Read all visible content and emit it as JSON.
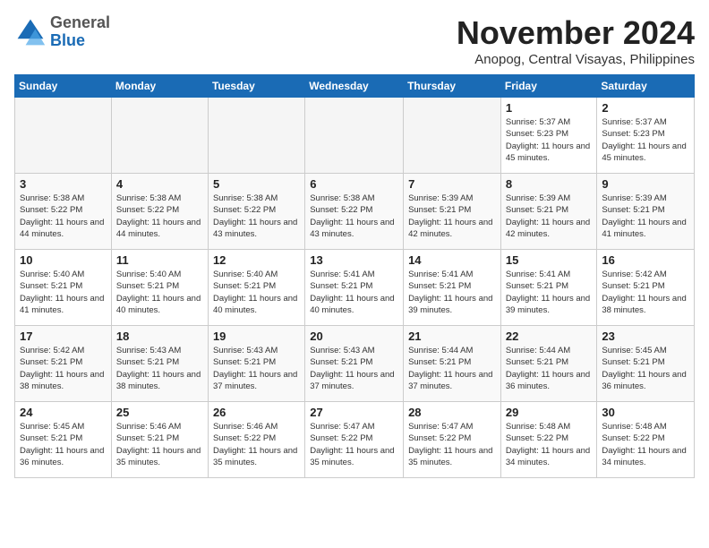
{
  "logo": {
    "general": "General",
    "blue": "Blue"
  },
  "header": {
    "title": "November 2024",
    "location": "Anopog, Central Visayas, Philippines"
  },
  "weekdays": [
    "Sunday",
    "Monday",
    "Tuesday",
    "Wednesday",
    "Thursday",
    "Friday",
    "Saturday"
  ],
  "weeks": [
    [
      {
        "day": "",
        "info": ""
      },
      {
        "day": "",
        "info": ""
      },
      {
        "day": "",
        "info": ""
      },
      {
        "day": "",
        "info": ""
      },
      {
        "day": "",
        "info": ""
      },
      {
        "day": "1",
        "info": "Sunrise: 5:37 AM\nSunset: 5:23 PM\nDaylight: 11 hours and 45 minutes."
      },
      {
        "day": "2",
        "info": "Sunrise: 5:37 AM\nSunset: 5:23 PM\nDaylight: 11 hours and 45 minutes."
      }
    ],
    [
      {
        "day": "3",
        "info": "Sunrise: 5:38 AM\nSunset: 5:22 PM\nDaylight: 11 hours and 44 minutes."
      },
      {
        "day": "4",
        "info": "Sunrise: 5:38 AM\nSunset: 5:22 PM\nDaylight: 11 hours and 44 minutes."
      },
      {
        "day": "5",
        "info": "Sunrise: 5:38 AM\nSunset: 5:22 PM\nDaylight: 11 hours and 43 minutes."
      },
      {
        "day": "6",
        "info": "Sunrise: 5:38 AM\nSunset: 5:22 PM\nDaylight: 11 hours and 43 minutes."
      },
      {
        "day": "7",
        "info": "Sunrise: 5:39 AM\nSunset: 5:21 PM\nDaylight: 11 hours and 42 minutes."
      },
      {
        "day": "8",
        "info": "Sunrise: 5:39 AM\nSunset: 5:21 PM\nDaylight: 11 hours and 42 minutes."
      },
      {
        "day": "9",
        "info": "Sunrise: 5:39 AM\nSunset: 5:21 PM\nDaylight: 11 hours and 41 minutes."
      }
    ],
    [
      {
        "day": "10",
        "info": "Sunrise: 5:40 AM\nSunset: 5:21 PM\nDaylight: 11 hours and 41 minutes."
      },
      {
        "day": "11",
        "info": "Sunrise: 5:40 AM\nSunset: 5:21 PM\nDaylight: 11 hours and 40 minutes."
      },
      {
        "day": "12",
        "info": "Sunrise: 5:40 AM\nSunset: 5:21 PM\nDaylight: 11 hours and 40 minutes."
      },
      {
        "day": "13",
        "info": "Sunrise: 5:41 AM\nSunset: 5:21 PM\nDaylight: 11 hours and 40 minutes."
      },
      {
        "day": "14",
        "info": "Sunrise: 5:41 AM\nSunset: 5:21 PM\nDaylight: 11 hours and 39 minutes."
      },
      {
        "day": "15",
        "info": "Sunrise: 5:41 AM\nSunset: 5:21 PM\nDaylight: 11 hours and 39 minutes."
      },
      {
        "day": "16",
        "info": "Sunrise: 5:42 AM\nSunset: 5:21 PM\nDaylight: 11 hours and 38 minutes."
      }
    ],
    [
      {
        "day": "17",
        "info": "Sunrise: 5:42 AM\nSunset: 5:21 PM\nDaylight: 11 hours and 38 minutes."
      },
      {
        "day": "18",
        "info": "Sunrise: 5:43 AM\nSunset: 5:21 PM\nDaylight: 11 hours and 38 minutes."
      },
      {
        "day": "19",
        "info": "Sunrise: 5:43 AM\nSunset: 5:21 PM\nDaylight: 11 hours and 37 minutes."
      },
      {
        "day": "20",
        "info": "Sunrise: 5:43 AM\nSunset: 5:21 PM\nDaylight: 11 hours and 37 minutes."
      },
      {
        "day": "21",
        "info": "Sunrise: 5:44 AM\nSunset: 5:21 PM\nDaylight: 11 hours and 37 minutes."
      },
      {
        "day": "22",
        "info": "Sunrise: 5:44 AM\nSunset: 5:21 PM\nDaylight: 11 hours and 36 minutes."
      },
      {
        "day": "23",
        "info": "Sunrise: 5:45 AM\nSunset: 5:21 PM\nDaylight: 11 hours and 36 minutes."
      }
    ],
    [
      {
        "day": "24",
        "info": "Sunrise: 5:45 AM\nSunset: 5:21 PM\nDaylight: 11 hours and 36 minutes."
      },
      {
        "day": "25",
        "info": "Sunrise: 5:46 AM\nSunset: 5:21 PM\nDaylight: 11 hours and 35 minutes."
      },
      {
        "day": "26",
        "info": "Sunrise: 5:46 AM\nSunset: 5:22 PM\nDaylight: 11 hours and 35 minutes."
      },
      {
        "day": "27",
        "info": "Sunrise: 5:47 AM\nSunset: 5:22 PM\nDaylight: 11 hours and 35 minutes."
      },
      {
        "day": "28",
        "info": "Sunrise: 5:47 AM\nSunset: 5:22 PM\nDaylight: 11 hours and 35 minutes."
      },
      {
        "day": "29",
        "info": "Sunrise: 5:48 AM\nSunset: 5:22 PM\nDaylight: 11 hours and 34 minutes."
      },
      {
        "day": "30",
        "info": "Sunrise: 5:48 AM\nSunset: 5:22 PM\nDaylight: 11 hours and 34 minutes."
      }
    ]
  ]
}
